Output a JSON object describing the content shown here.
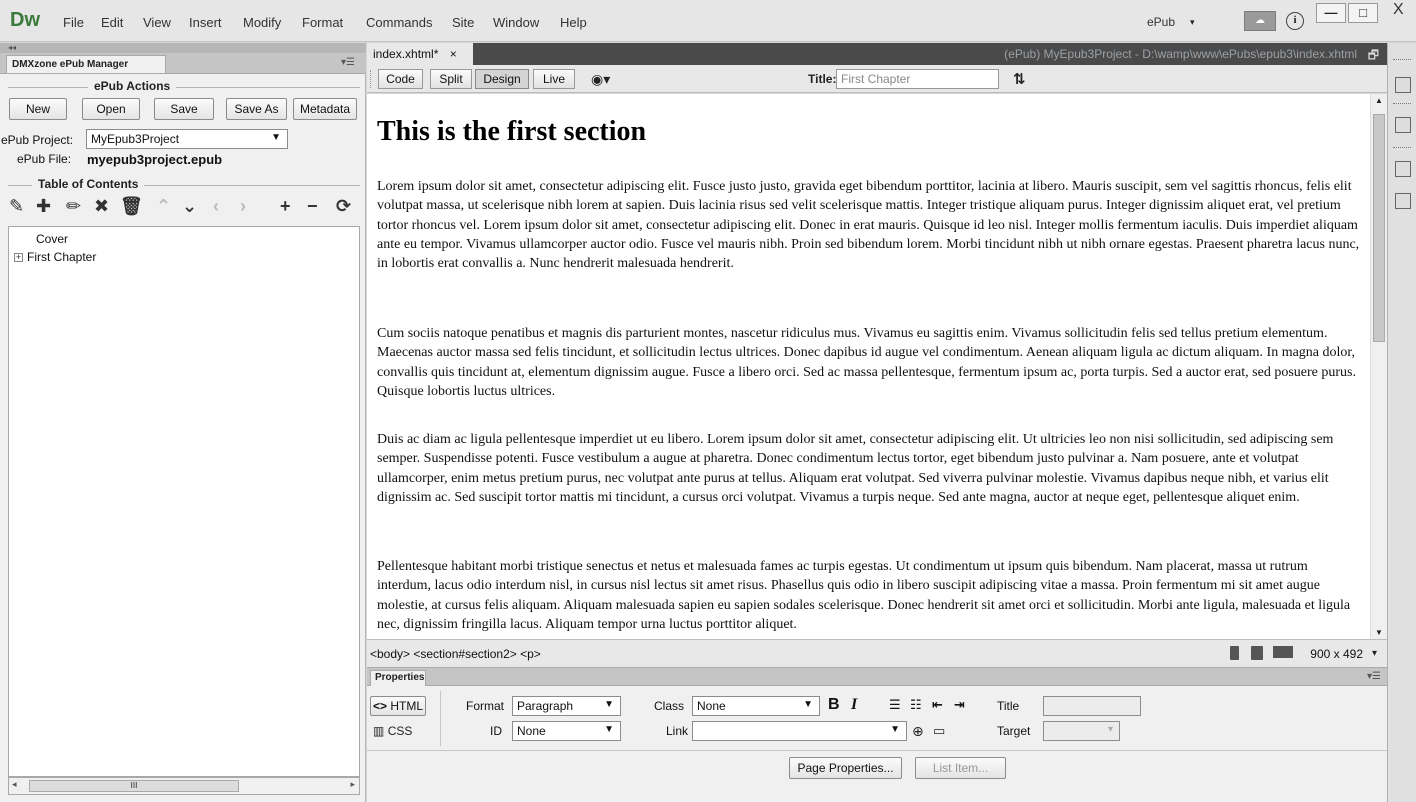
{
  "app": {
    "logo": "Dw",
    "menu": [
      "File",
      "Edit",
      "View",
      "Insert",
      "Modify",
      "Format",
      "Commands",
      "Site",
      "Window",
      "Help"
    ],
    "workspace": "ePub",
    "window_controls": {
      "minimize": "—",
      "maximize": "□",
      "close": "X"
    }
  },
  "left_panel": {
    "tab_label": "DMXzone ePub Manager",
    "collapse": "◂◂",
    "actions_title": "ePub Actions",
    "buttons": {
      "new": "New",
      "open": "Open",
      "save": "Save",
      "save_as": "Save As",
      "metadata": "Metadata"
    },
    "project_label": "ePub Project:",
    "project_value": "MyEpub3Project",
    "file_label": "ePub File:",
    "file_value": "myepub3project.epub",
    "toc_title": "Table of Contents",
    "toc_tools": [
      "edit-icon",
      "add-icon",
      "pencil-icon",
      "delete-icon",
      "trash-icon",
      "move-up-icon",
      "move-down-icon",
      "move-left-icon",
      "move-right-icon",
      "add-child-icon",
      "remove-icon",
      "refresh-icon"
    ],
    "toc_items": [
      {
        "label": "Cover",
        "expandable": false
      },
      {
        "label": "First Chapter",
        "expandable": true
      }
    ],
    "scroll_thumb": "III"
  },
  "document": {
    "tab_label": "index.xhtml*",
    "tab_close": "×",
    "file_path": "(ePub) MyEpub3Project - D:\\wamp\\www\\ePubs\\epub3\\index.xhtml",
    "views": {
      "code": "Code",
      "split": "Split",
      "design": "Design",
      "live": "Live"
    },
    "title_label": "Title:",
    "title_value": "First Chapter",
    "heading": "This is the first section",
    "paragraphs": [
      "Lorem ipsum dolor sit amet, consectetur adipiscing elit. Fusce justo justo, gravida eget bibendum porttitor, lacinia at libero. Mauris suscipit, sem vel sagittis rhoncus, felis elit volutpat massa, ut scelerisque nibh lorem at sapien. Duis lacinia risus sed velit scelerisque mattis. Integer tristique aliquam purus. Integer dignissim aliquet erat, vel pretium tortor rhoncus vel. Lorem ipsum dolor sit amet, consectetur adipiscing elit. Donec in erat mauris. Quisque id leo nisl. Integer mollis fermentum iaculis. Duis imperdiet aliquam ante eu tempor. Vivamus ullamcorper auctor odio. Fusce vel mauris nibh. Proin sed bibendum lorem. Morbi tincidunt nibh ut nibh ornare egestas. Praesent pharetra lacus nunc, in lobortis erat convallis a. Nunc hendrerit malesuada hendrerit.",
      "Cum sociis natoque penatibus et magnis dis parturient montes, nascetur ridiculus mus. Vivamus eu sagittis enim. Vivamus sollicitudin felis sed tellus pretium elementum. Maecenas auctor massa sed felis tincidunt, et sollicitudin lectus ultrices. Donec dapibus id augue vel condimentum. Aenean aliquam ligula ac dictum aliquam. In magna dolor, convallis quis tincidunt at, elementum dignissim augue. Fusce a libero orci. Sed ac massa pellentesque, fermentum ipsum ac, porta turpis. Sed a auctor erat, sed posuere purus. Quisque lobortis luctus ultrices.",
      "Duis ac diam ac ligula pellentesque imperdiet ut eu libero. Lorem ipsum dolor sit amet, consectetur adipiscing elit. Ut ultricies leo non nisi sollicitudin, sed adipiscing sem semper. Suspendisse potenti. Fusce vestibulum a augue at pharetra. Donec condimentum lectus tortor, eget bibendum justo pulvinar a. Nam posuere, ante et volutpat ullamcorper, enim metus pretium purus, nec volutpat ante purus at tellus. Aliquam erat volutpat. Sed viverra pulvinar molestie. Vivamus dapibus neque nibh, et varius elit dignissim ac. Sed suscipit tortor mattis mi tincidunt, a cursus orci volutpat. Vivamus a turpis neque. Sed ante magna, auctor at neque eget, pellentesque aliquet enim.",
      "Pellentesque habitant morbi tristique senectus et netus et malesuada fames ac turpis egestas. Ut condimentum ut ipsum quis bibendum. Nam placerat, massa ut rutrum interdum, lacus odio interdum nisl, in cursus nisl lectus sit amet risus. Phasellus quis odio in libero suscipit adipiscing vitae a massa. Proin fermentum mi sit amet augue molestie, at cursus felis aliquam. Aliquam malesuada sapien eu sapien sodales scelerisque. Donec hendrerit sit amet orci et sollicitudin. Morbi ante ligula, malesuada et ligula nec, dignissim fringilla lacus. Aliquam tempor urna luctus porttitor aliquet."
    ],
    "tag_selector": "<body> <section#section2> <p>",
    "window_size": "900 x 492"
  },
  "properties": {
    "tab_label": "Properties",
    "html_btn": "HTML",
    "css_btn": "CSS",
    "format_label": "Format",
    "format_value": "Paragraph",
    "id_label": "ID",
    "id_value": "None",
    "class_label": "Class",
    "class_value": "None",
    "link_label": "Link",
    "link_value": "",
    "bold": "B",
    "italic": "I",
    "title_label": "Title",
    "title_value": "",
    "target_label": "Target",
    "target_value": "",
    "page_properties": "Page Properties...",
    "list_item": "List Item..."
  },
  "colors": {
    "logo": "#3a7a3a",
    "doc_tab_bar": "#4a4a4a",
    "path_text": "#9aa0a6"
  }
}
